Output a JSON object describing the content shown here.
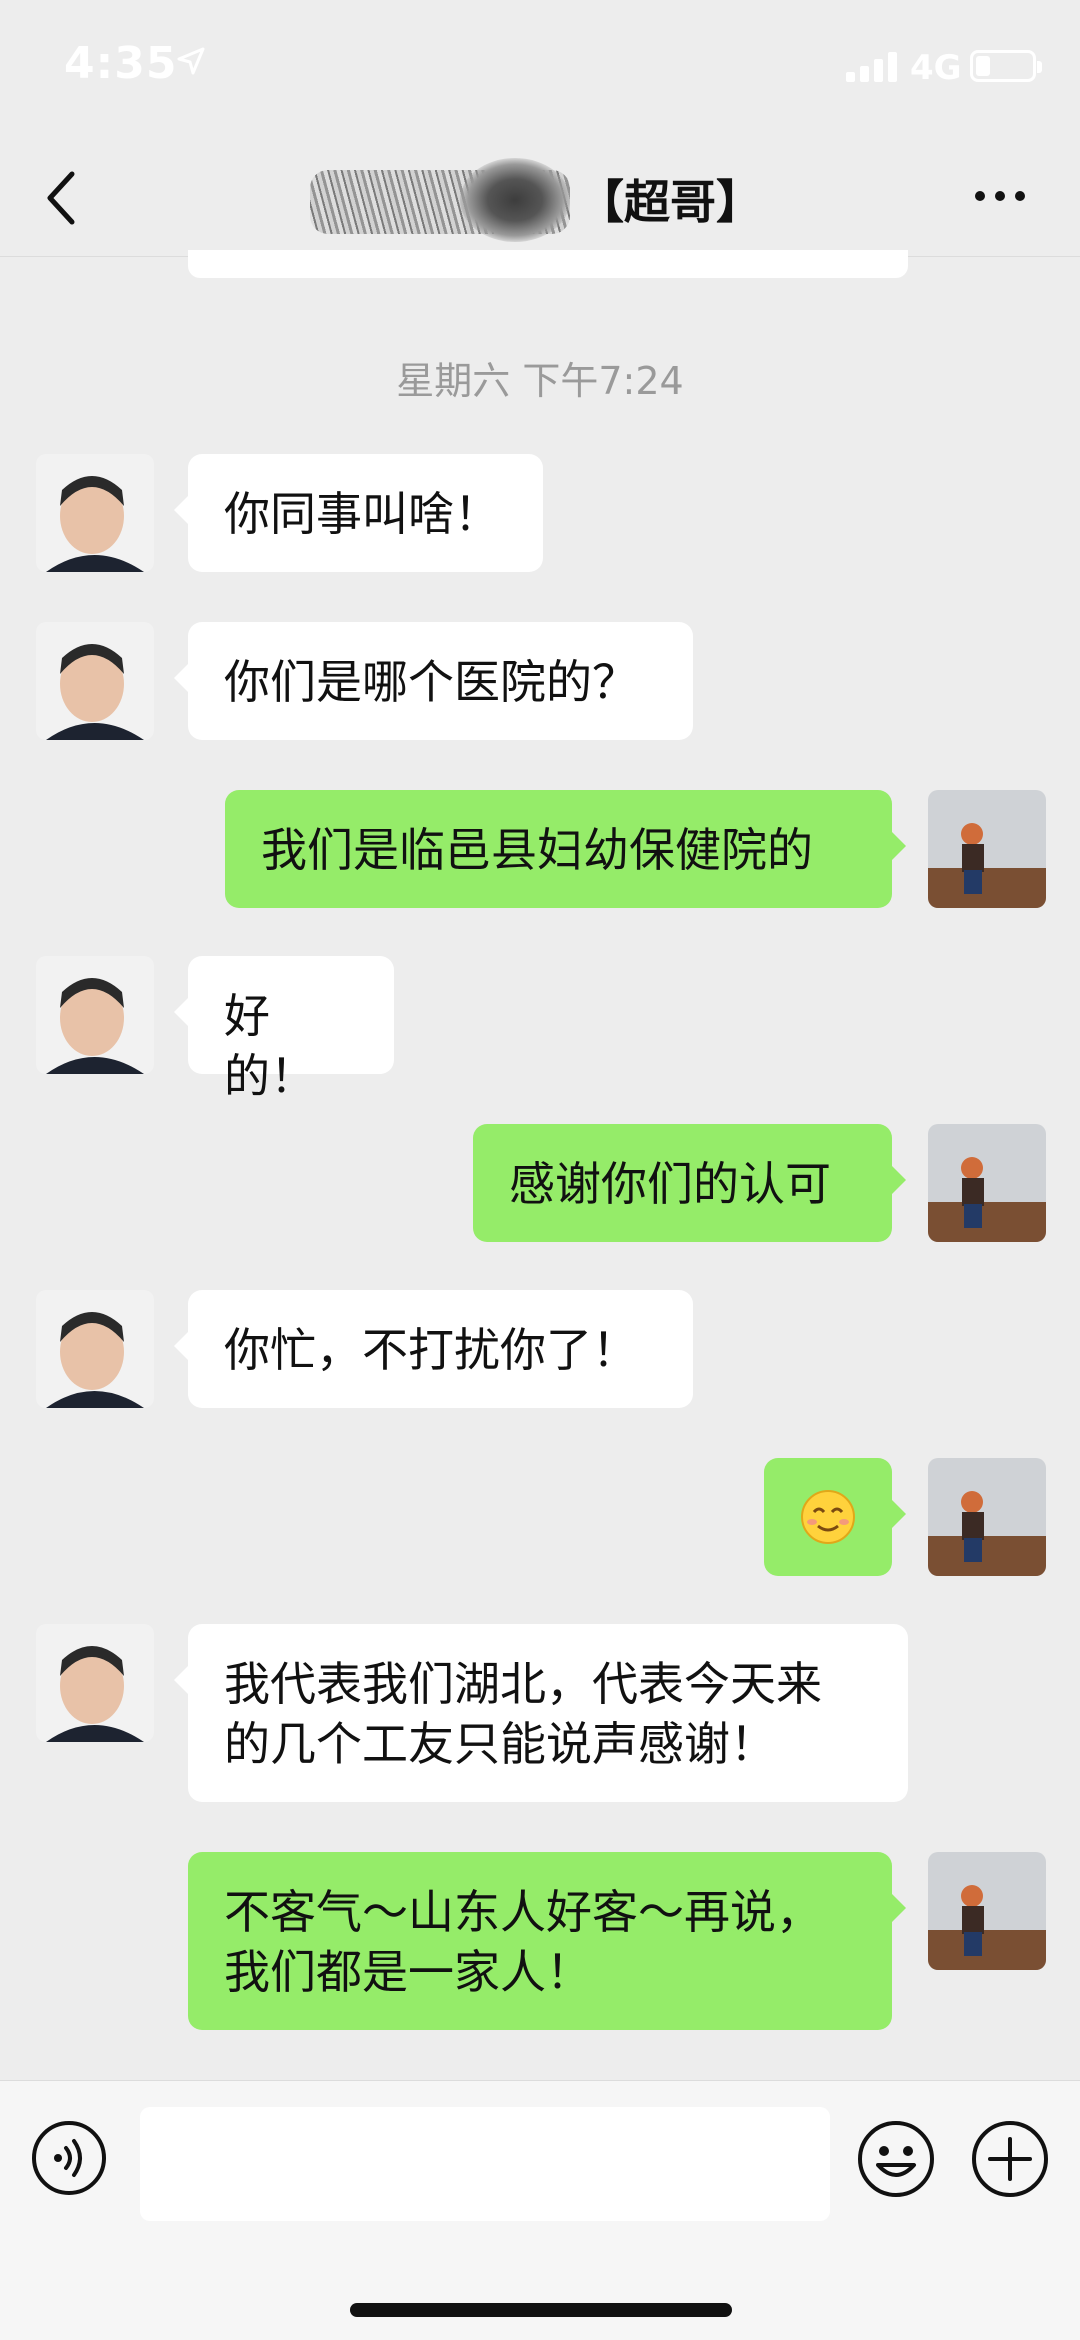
{
  "status": {
    "time": "4:35",
    "network": "4G"
  },
  "header": {
    "title": "【超哥】"
  },
  "timestamp": "星期六 下午7:24",
  "messages": [
    {
      "side": "in",
      "text": "你同事叫啥！"
    },
    {
      "side": "in",
      "text": "你们是哪个医院的？"
    },
    {
      "side": "out",
      "text": "我们是临邑县妇幼保健院的"
    },
    {
      "side": "in",
      "text": "好的！"
    },
    {
      "side": "out",
      "text": "感谢你们的认可"
    },
    {
      "side": "in",
      "text": "你忙，不打扰你了！"
    },
    {
      "side": "out",
      "emoji": "smile"
    },
    {
      "side": "in",
      "line1": "我代表我们湖北，代表今天来",
      "line2": "的几个工友只能说声感谢！"
    },
    {
      "side": "out",
      "line1": "不客气～山东人好客～再说，",
      "line2": "我们都是一家人！"
    }
  ],
  "colors": {
    "background": "#ededed",
    "outgoing_bubble": "#95ec69",
    "incoming_bubble": "#ffffff"
  },
  "icons": {
    "back": "chevron-left-icon",
    "more": "more-dots-icon",
    "voice": "voice-icon",
    "emoji": "emoji-icon",
    "add": "plus-icon"
  }
}
